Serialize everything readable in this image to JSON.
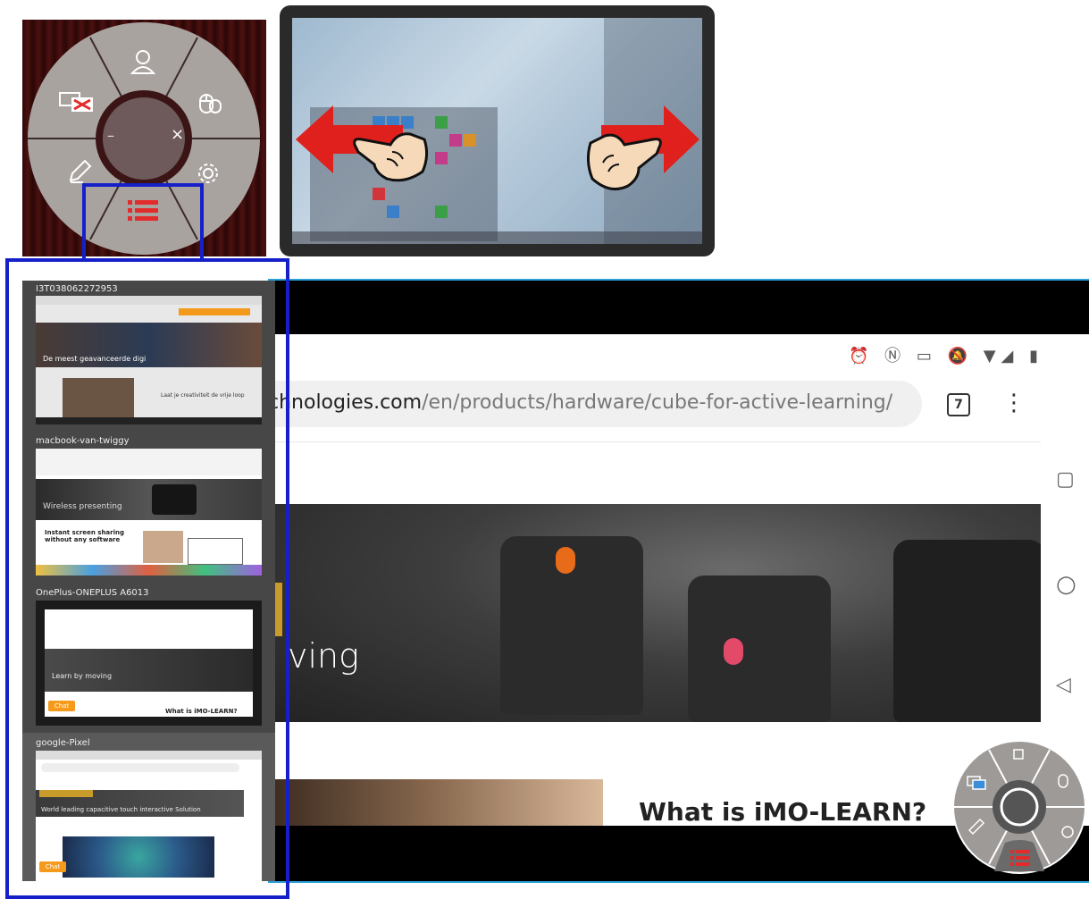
{
  "radial_menu": {
    "items": [
      {
        "name": "user-icon",
        "label": "User"
      },
      {
        "name": "mouse-icon",
        "label": "Mouse"
      },
      {
        "name": "settings-icon",
        "label": "Settings"
      },
      {
        "name": "list-icon",
        "label": "Device list"
      },
      {
        "name": "pen-icon",
        "label": "Annotate"
      },
      {
        "name": "screen-share-disabled-icon",
        "label": "Stop sharing"
      }
    ],
    "center_minimize": "–",
    "center_close": "×",
    "accent_color": "#e32b2b"
  },
  "browser": {
    "url_domain": "chnologies.com",
    "url_path": "/en/products/hardware/cube-for-active-learning/",
    "tab_count": "7",
    "menu": "⋮",
    "status_icons": "⏰ Ⓝ ▭ 🔕 ▼◢ ▮",
    "hero_text": "ving",
    "section_heading": "What is iMO-LEARN?"
  },
  "android_nav": {
    "recent": "▢",
    "home": "○",
    "back": "◁"
  },
  "device_list": {
    "devices": [
      {
        "name": "I3T038062272953",
        "thumb_text_1": "De meest geavanceerde digi",
        "thumb_text_2": "Laat je creativiteit de vrije loop"
      },
      {
        "name": "macbook-van-twiggy",
        "thumb_text_1": "Wireless presenting",
        "thumb_text_2": "Instant screen sharing without any software"
      },
      {
        "name": "OnePlus-ONEPLUS A6013",
        "thumb_text_1": "Learn by moving",
        "thumb_text_2": "What is iMO-LEARN?",
        "chat": "Chat"
      },
      {
        "name": "google-Pixel",
        "thumb_text_1": "World leading capacitive touch interactive Solution",
        "thumb_text_2": "",
        "chat": "Chat"
      }
    ]
  },
  "colors": {
    "highlight": "#1520c8",
    "accent": "#e32b2b",
    "chat": "#f59a1b"
  }
}
